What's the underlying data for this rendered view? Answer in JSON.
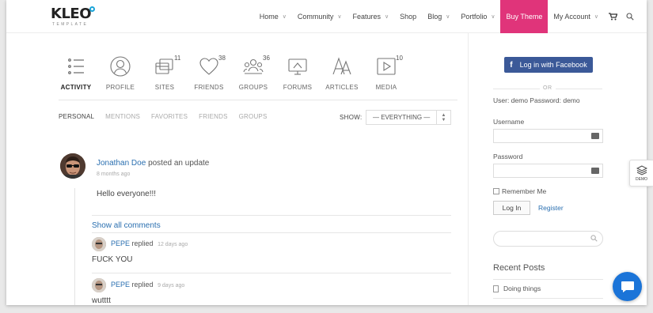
{
  "header": {
    "logo_text": "KLEO",
    "logo_sub": "TEMPLATE",
    "nav": [
      {
        "label": "Home",
        "caret": true
      },
      {
        "label": "Community",
        "caret": true
      },
      {
        "label": "Features",
        "caret": true
      },
      {
        "label": "Shop",
        "caret": false
      },
      {
        "label": "Blog",
        "caret": true
      },
      {
        "label": "Portfolio",
        "caret": true
      },
      {
        "label": "Buy Theme",
        "caret": false
      },
      {
        "label": "My Account",
        "caret": true
      }
    ],
    "icons": [
      "cart-icon",
      "search-icon"
    ]
  },
  "profile_tabs": [
    {
      "label": "ACTIVITY",
      "count": "",
      "icon": "activity-icon"
    },
    {
      "label": "PROFILE",
      "count": "",
      "icon": "profile-icon"
    },
    {
      "label": "SITES",
      "count": "11",
      "icon": "sites-icon"
    },
    {
      "label": "FRIENDS",
      "count": "38",
      "icon": "heart-icon"
    },
    {
      "label": "GROUPS",
      "count": "36",
      "icon": "groups-icon"
    },
    {
      "label": "FORUMS",
      "count": "",
      "icon": "forums-icon"
    },
    {
      "label": "ARTICLES",
      "count": "",
      "icon": "articles-icon"
    },
    {
      "label": "MEDIA",
      "count": "10",
      "icon": "media-icon"
    }
  ],
  "subtabs": [
    "PERSONAL",
    "MENTIONS",
    "FAVORITES",
    "FRIENDS",
    "GROUPS"
  ],
  "filter": {
    "label": "SHOW:",
    "value": "— EVERYTHING —"
  },
  "activity": {
    "author": "Jonathan Doe",
    "action": "posted an update",
    "time": "8 months ago",
    "text": "Hello everyone!!!",
    "show_all": "Show all comments",
    "replies": [
      {
        "author": "PEPE",
        "action": "replied",
        "time": "12 days ago",
        "text": "FUCK YOU"
      },
      {
        "author": "PEPE",
        "action": "replied",
        "time": "9 days ago",
        "text": "wutttt"
      }
    ]
  },
  "sidebar": {
    "facebook_label": "Log in with Facebook",
    "or_text": "OR",
    "demo_credentials": "User: demo Password: demo",
    "username_label": "Username",
    "password_label": "Password",
    "remember_label": "Remember Me",
    "login_label": "Log In",
    "register_label": "Register",
    "recent_title": "Recent Posts",
    "recent_posts": [
      "Doing things"
    ]
  },
  "demo_tab_label": "DEMO",
  "colors": {
    "accent": "#e0347a",
    "link": "#2a6fb0",
    "facebook": "#3b5998",
    "chat": "#1b74d8"
  }
}
